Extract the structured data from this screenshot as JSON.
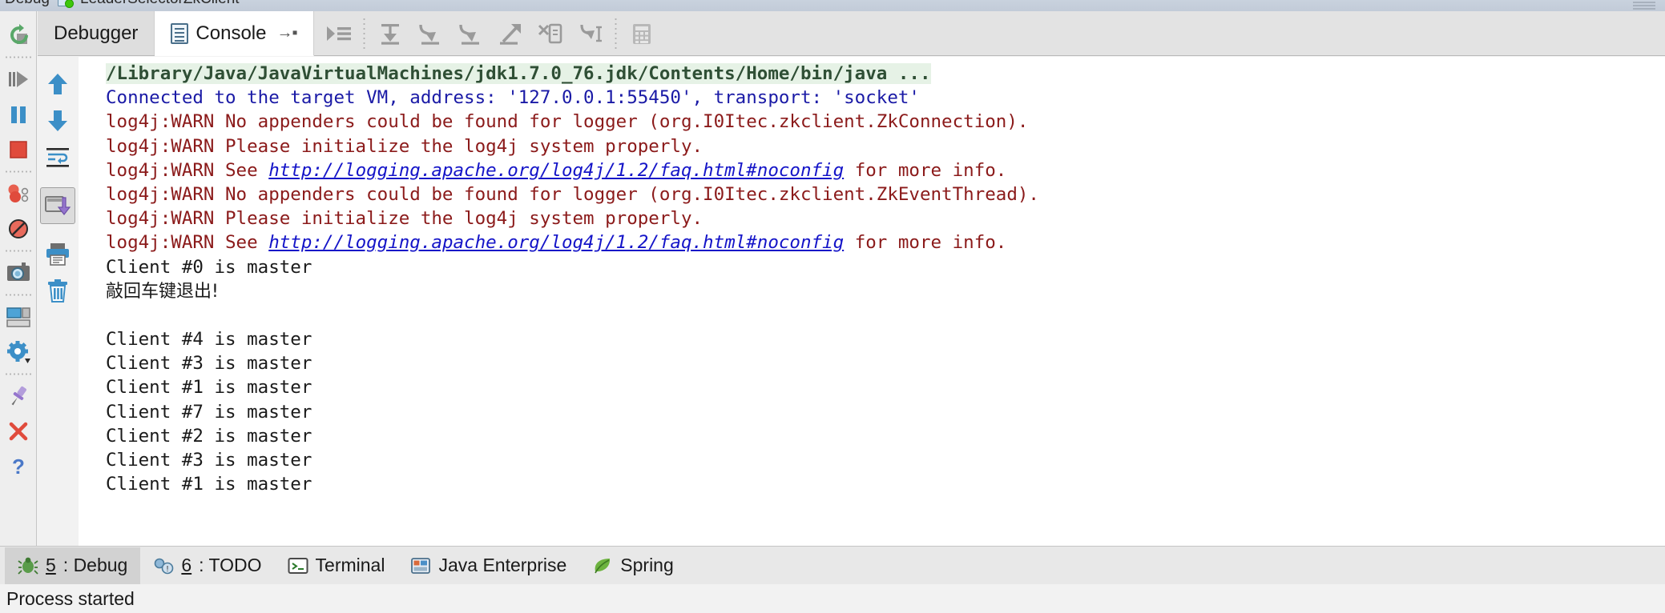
{
  "window": {
    "title_prefix": "Debug",
    "title_name": "LeaderSelectorZkClient",
    "doc_icon": "document-running-icon",
    "maximize_icon": "maximize-dots-icon"
  },
  "tabs": [
    {
      "label": "Debugger",
      "icon": "",
      "active": false,
      "name": "tab-debugger"
    },
    {
      "label": "Console",
      "icon": "console-doc-icon",
      "pin": "→▪",
      "active": true,
      "name": "tab-console"
    }
  ],
  "tab_toolbar": [
    {
      "name": "force-step-into-icon",
      "tooltip": "Force Step Into"
    },
    {
      "name": "step-over-icon",
      "tooltip": "Step Over"
    },
    {
      "name": "step-into-icon",
      "tooltip": "Step Into"
    },
    {
      "name": "step-out-icon",
      "tooltip": "Step Out"
    },
    {
      "name": "run-to-cursor-icon",
      "tooltip": "Run to Cursor"
    },
    {
      "name": "drop-frame-icon",
      "tooltip": "Drop Frame"
    },
    {
      "name": "force-run-to-cursor-icon",
      "tooltip": "Force Run to Cursor"
    },
    {
      "name": "evaluate-expression-icon",
      "tooltip": "Evaluate Expression"
    }
  ],
  "left_rail": [
    {
      "name": "rerun-icon",
      "tooltip": "Rerun"
    },
    {
      "name": "resume-program-icon",
      "tooltip": "Resume Program"
    },
    {
      "name": "pause-program-icon",
      "tooltip": "Pause Program"
    },
    {
      "name": "stop-icon",
      "tooltip": "Stop"
    },
    {
      "name": "view-breakpoints-icon",
      "tooltip": "View Breakpoints"
    },
    {
      "name": "mute-breakpoints-icon",
      "tooltip": "Mute Breakpoints"
    },
    {
      "name": "get-thread-dump-icon",
      "tooltip": "Get Thread Dump"
    },
    {
      "name": "settings-layout-icon",
      "tooltip": "Restore Layout"
    },
    {
      "name": "settings-gear-icon",
      "tooltip": "Settings"
    },
    {
      "name": "pin-tab-icon",
      "tooltip": "Pin Tab"
    },
    {
      "name": "close-icon",
      "tooltip": "Close"
    },
    {
      "name": "help-icon",
      "tooltip": "Help"
    }
  ],
  "console_rail": [
    {
      "name": "scroll-up-icon",
      "tooltip": "Up the Stack Trace"
    },
    {
      "name": "scroll-down-icon",
      "tooltip": "Down the Stack Trace"
    },
    {
      "name": "soft-wrap-icon",
      "tooltip": "Use Soft Wraps"
    },
    {
      "name": "scroll-to-end-icon",
      "tooltip": "Scroll to the End",
      "selected": true
    },
    {
      "name": "print-icon",
      "tooltip": "Print"
    },
    {
      "name": "clear-all-icon",
      "tooltip": "Clear All"
    }
  ],
  "console": {
    "lines": [
      {
        "type": "cmd",
        "segments": [
          {
            "style": "cmd",
            "text": "/Library/Java/JavaVirtualMachines/jdk1.7.0_76.jdk/Contents/Home/bin/java ..."
          }
        ]
      },
      {
        "type": "info",
        "segments": [
          {
            "style": "info",
            "text": "Connected to the target VM, address: '127.0.0.1:55450', transport: 'socket'"
          }
        ]
      },
      {
        "type": "warn",
        "segments": [
          {
            "style": "warn",
            "text": "log4j:WARN No appenders could be found for logger (org.I0Itec.zkclient.ZkConnection)."
          }
        ]
      },
      {
        "type": "warn",
        "segments": [
          {
            "style": "warn",
            "text": "log4j:WARN Please initialize the log4j system properly."
          }
        ]
      },
      {
        "type": "warn",
        "segments": [
          {
            "style": "warn",
            "text": "log4j:WARN See "
          },
          {
            "style": "link",
            "text": "http://logging.apache.org/log4j/1.2/faq.html#noconfig"
          },
          {
            "style": "warn",
            "text": " for more info."
          }
        ]
      },
      {
        "type": "warn",
        "segments": [
          {
            "style": "warn",
            "text": "log4j:WARN No appenders could be found for logger (org.I0Itec.zkclient.ZkEventThread)."
          }
        ]
      },
      {
        "type": "warn",
        "segments": [
          {
            "style": "warn",
            "text": "log4j:WARN Please initialize the log4j system properly."
          }
        ]
      },
      {
        "type": "warn",
        "segments": [
          {
            "style": "warn",
            "text": "log4j:WARN See "
          },
          {
            "style": "link",
            "text": "http://logging.apache.org/log4j/1.2/faq.html#noconfig"
          },
          {
            "style": "warn",
            "text": " for more info."
          }
        ]
      },
      {
        "type": "out",
        "segments": [
          {
            "style": "out",
            "text": "Client #0 is master"
          }
        ]
      },
      {
        "type": "out",
        "segments": [
          {
            "style": "out-cjk",
            "text": "敲回车键退出!"
          }
        ]
      },
      {
        "type": "blank",
        "segments": [
          {
            "style": "out",
            "text": ""
          }
        ]
      },
      {
        "type": "out",
        "segments": [
          {
            "style": "out",
            "text": "Client #4 is master"
          }
        ]
      },
      {
        "type": "out",
        "segments": [
          {
            "style": "out",
            "text": "Client #3 is master"
          }
        ]
      },
      {
        "type": "out",
        "segments": [
          {
            "style": "out",
            "text": "Client #1 is master"
          }
        ]
      },
      {
        "type": "out",
        "segments": [
          {
            "style": "out",
            "text": "Client #7 is master"
          }
        ]
      },
      {
        "type": "out",
        "segments": [
          {
            "style": "out",
            "text": "Client #2 is master"
          }
        ]
      },
      {
        "type": "out",
        "segments": [
          {
            "style": "out",
            "text": "Client #3 is master"
          }
        ]
      },
      {
        "type": "out",
        "segments": [
          {
            "style": "out",
            "text": "Client #1 is master"
          }
        ]
      }
    ]
  },
  "bottom_bar": [
    {
      "mnemonic": "5",
      "label": ": Debug",
      "icon": "debug-bug-icon",
      "active": true,
      "name": "bottom-tab-debug"
    },
    {
      "mnemonic": "6",
      "label": ": TODO",
      "icon": "todo-icon",
      "active": false,
      "name": "bottom-tab-todo"
    },
    {
      "mnemonic": "",
      "label": "Terminal",
      "icon": "terminal-icon",
      "active": false,
      "name": "bottom-tab-terminal"
    },
    {
      "mnemonic": "",
      "label": "Java Enterprise",
      "icon": "java-enterprise-icon",
      "active": false,
      "name": "bottom-tab-java-enterprise"
    },
    {
      "mnemonic": "",
      "label": "Spring",
      "icon": "spring-leaf-icon",
      "active": false,
      "name": "bottom-tab-spring"
    }
  ],
  "status": {
    "text": "Process started"
  },
  "colors": {
    "cmd_text": "#2f4f35",
    "cmd_bg": "#e6f2e6",
    "info_text": "#1a1aa6",
    "warn_text": "#8b1a1a",
    "link_text": "#1414c8",
    "out_text": "#1a1a1a",
    "accent_blue": "#3c8fc7",
    "stop_red": "#e04b3c",
    "resume_green": "#59a869"
  }
}
